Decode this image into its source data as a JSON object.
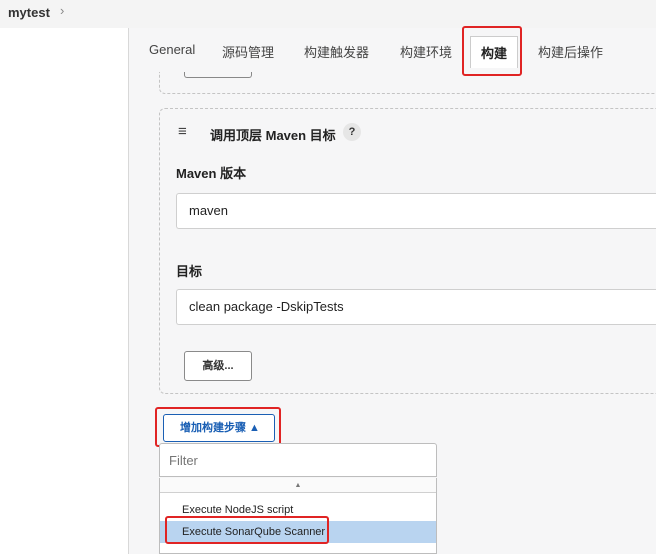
{
  "breadcrumb": {
    "project": "mytest",
    "separator": "›"
  },
  "tabs": [
    {
      "label": "General"
    },
    {
      "label": "源码管理"
    },
    {
      "label": "构建触发器"
    },
    {
      "label": "构建环境"
    },
    {
      "label": "构建",
      "active": true
    },
    {
      "label": "构建后操作"
    }
  ],
  "step": {
    "drag_icon": "≡",
    "title": "调用顶层 Maven 目标",
    "help_icon": "?",
    "maven_version_label": "Maven 版本",
    "maven_version_value": "maven",
    "goals_label": "目标",
    "goals_value": "clean package -DskipTests",
    "advanced_label": "高级..."
  },
  "add_step": {
    "label": "增加构建步骤 ▲"
  },
  "filter": {
    "placeholder": "Filter"
  },
  "dropdown": {
    "scroll_up_icon": "▲",
    "options": [
      {
        "label": "Execute NodeJS script"
      },
      {
        "label": "Execute SonarQube Scanner",
        "selected": true
      }
    ]
  },
  "colors": {
    "highlight": "#e02424",
    "accent": "#1a5fb4",
    "selected": "#b9d4f0"
  }
}
